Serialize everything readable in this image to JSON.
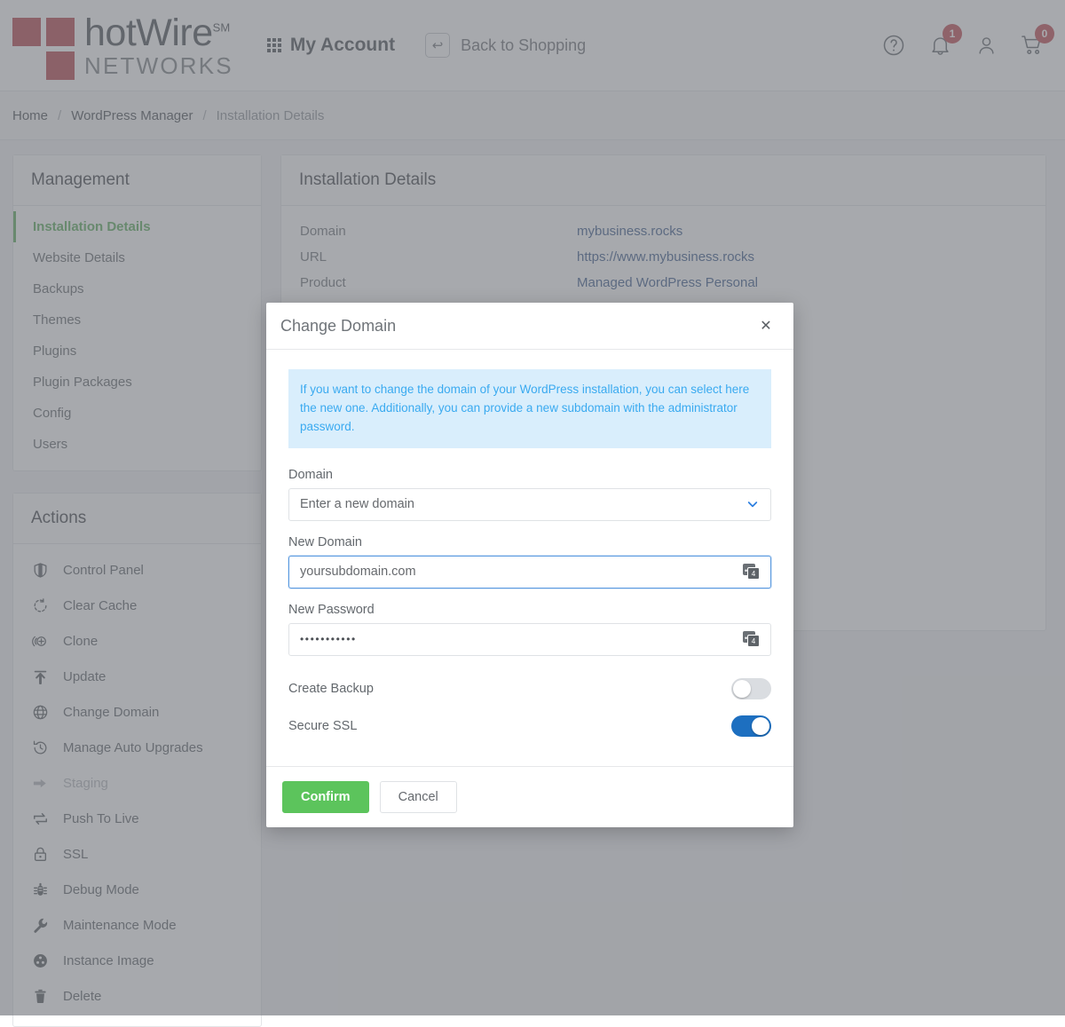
{
  "header": {
    "logo": {
      "main": "hotWire",
      "sm": "SM",
      "sub": "NETWORKS"
    },
    "my_account_label": "My Account",
    "back_to_shopping_label": "Back to Shopping",
    "enter_icon_glyph": "↩",
    "icons": {
      "help": "help-circle-icon",
      "bell": "bell-icon",
      "user": "user-icon",
      "cart": "cart-icon"
    },
    "bell_badge": "1",
    "cart_badge": "0"
  },
  "breadcrumb": {
    "items": [
      {
        "label": "Home",
        "current": false
      },
      {
        "label": "WordPress Manager",
        "current": false
      },
      {
        "label": "Installation Details",
        "current": true
      }
    ],
    "separator": "/"
  },
  "sidebar": {
    "management": {
      "title": "Management",
      "items": [
        {
          "label": "Installation Details",
          "active": true
        },
        {
          "label": "Website Details",
          "active": false
        },
        {
          "label": "Backups",
          "active": false
        },
        {
          "label": "Themes",
          "active": false
        },
        {
          "label": "Plugins",
          "active": false
        },
        {
          "label": "Plugin Packages",
          "active": false
        },
        {
          "label": "Config",
          "active": false
        },
        {
          "label": "Users",
          "active": false
        }
      ]
    },
    "actions": {
      "title": "Actions",
      "items": [
        {
          "label": "Control Panel",
          "icon": "shield-icon",
          "disabled": false
        },
        {
          "label": "Clear Cache",
          "icon": "refresh-dashed-icon",
          "disabled": false
        },
        {
          "label": "Clone",
          "icon": "clone-plus-icon",
          "disabled": false
        },
        {
          "label": "Update",
          "icon": "upload-arrow-icon",
          "disabled": false
        },
        {
          "label": "Change Domain",
          "icon": "globe-icon",
          "disabled": false
        },
        {
          "label": "Manage Auto Upgrades",
          "icon": "history-clock-icon",
          "disabled": false
        },
        {
          "label": "Staging",
          "icon": "arrow-right-icon",
          "disabled": true
        },
        {
          "label": "Push To Live",
          "icon": "swap-arrows-icon",
          "disabled": false
        },
        {
          "label": "SSL",
          "icon": "lock-icon",
          "disabled": false
        },
        {
          "label": "Debug Mode",
          "icon": "bug-icon",
          "disabled": false
        },
        {
          "label": "Maintenance Mode",
          "icon": "wrench-icon",
          "disabled": false
        },
        {
          "label": "Instance Image",
          "icon": "film-reel-icon",
          "disabled": false
        },
        {
          "label": "Delete",
          "icon": "trash-icon",
          "disabled": false
        }
      ]
    }
  },
  "main": {
    "title": "Installation Details",
    "rows": [
      {
        "label": "Domain",
        "value": "mybusiness.rocks"
      },
      {
        "label": "URL",
        "value": "https://www.mybusiness.rocks"
      },
      {
        "label": "Product",
        "value": "Managed WordPress Personal"
      }
    ]
  },
  "modal": {
    "title": "Change Domain",
    "close_glyph": "✕",
    "info": "If you want to change the domain of your WordPress installation, you can select here the new one. Additionally, you can provide a new subdomain with the administrator password.",
    "domain_field": {
      "label": "Domain",
      "value": "Enter a new domain",
      "options": [
        "Enter a new domain"
      ]
    },
    "new_domain_field": {
      "label": "New Domain",
      "value": "yoursubdomain.com",
      "placeholder": "yoursubdomain.com",
      "focused": true
    },
    "new_password_field": {
      "label": "New Password",
      "value": "•••••••••••"
    },
    "create_backup": {
      "label": "Create Backup",
      "on": false
    },
    "secure_ssl": {
      "label": "Secure SSL",
      "on": true
    },
    "confirm_label": "Confirm",
    "cancel_label": "Cancel"
  },
  "colors": {
    "brand_red": "#b6424a",
    "accent_green": "#5aab5a",
    "confirm_green": "#5cc45c",
    "link_blue": "#3a5a8c",
    "info_blue": "#3aaaf0",
    "info_bg": "#d9eefc",
    "toggle_on": "#1d6fc0",
    "badge_red": "#c0484f"
  }
}
